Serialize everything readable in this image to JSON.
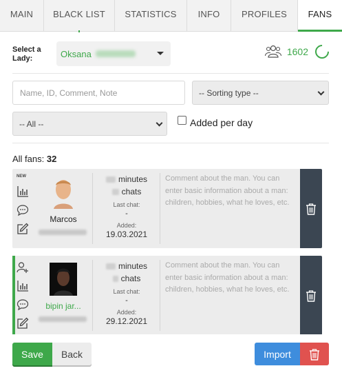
{
  "tabs": [
    {
      "label": "MAIN"
    },
    {
      "label": "BLACK LIST"
    },
    {
      "label": "STATISTICS"
    },
    {
      "label": "INFO"
    },
    {
      "label": "PROFILES"
    },
    {
      "label": "FANS",
      "active": true
    }
  ],
  "lady": {
    "label_line1": "Select a",
    "label_line2": "Lady:",
    "selected_name": "Oksana"
  },
  "fans_total": "1602",
  "filters": {
    "search_placeholder": "Name, ID, Comment, Note",
    "sorting_value": "-- Sorting type --",
    "period_value": "-- All --",
    "added_per_day_label": "Added per day",
    "added_per_day_checked": false
  },
  "all_fans_label": "All fans:",
  "all_fans_count": "32",
  "fans": [
    {
      "badge": "NEW",
      "name": "Marcos",
      "minutes_label": "minutes",
      "chats_label": "chats",
      "last_chat_label": "Last chat:",
      "last_chat_value": "-",
      "added_label": "Added:",
      "added_value": "19.03.2021",
      "comment_placeholder": "Comment about the man. You can enter basic information about a man: children, hobbies, what he loves, etc."
    },
    {
      "badge": "",
      "name": "bipin jar...",
      "minutes_label": "minutes",
      "chats_label": "chats",
      "last_chat_label": "Last chat:",
      "last_chat_value": "-",
      "added_label": "Added:",
      "added_value": "29.12.2021",
      "comment_placeholder": "Comment about the man. You can enter basic information about a man: children, hobbies, what he loves, etc."
    }
  ],
  "buttons": {
    "save": "Save",
    "back": "Back",
    "import": "Import"
  },
  "colors": {
    "accent_green": "#3ea84a",
    "import_blue": "#3e8ddd",
    "delete_red": "#e0524f",
    "trash_panel": "#3b4652"
  }
}
